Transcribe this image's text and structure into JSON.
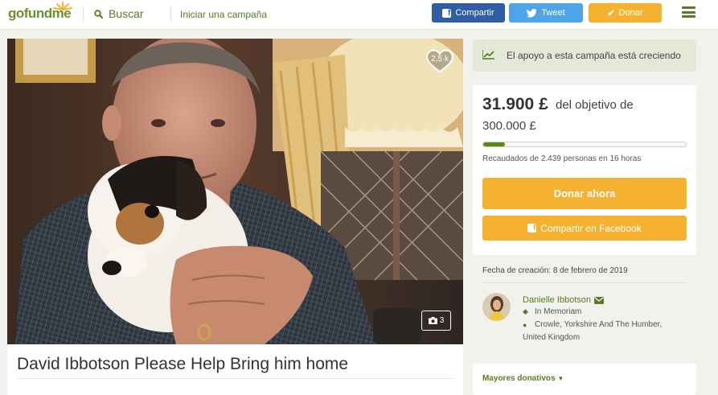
{
  "header": {
    "logo": "gofundme",
    "search_label": "Buscar",
    "start_campaign": "Iniciar una campaña",
    "share_label": "Compartir",
    "tweet_label": "Tweet",
    "donate_label": "Donar"
  },
  "photo": {
    "likes": "2,5 k",
    "photo_count": "3"
  },
  "campaign": {
    "title": "David Ibbotson Please Help Bring him home"
  },
  "sidebar": {
    "trend_banner": "El apoyo a esta campaña está creciendo",
    "raised": "31.900 £",
    "goal_prefix": "del objetivo de",
    "goal": "300.000 £",
    "progress_fraction": 0.106,
    "stats": "Recaudados de 2.439 personas en 16 horas",
    "donate_now": "Donar ahora",
    "share_facebook": "Compartir en Facebook",
    "created": "Fecha de creación: 8 de febrero de 2019",
    "organizer_name": "Danielle Ibbotson",
    "category": "In Memoriam",
    "location_line1": "Crowle, Yorkshire And The Humber,",
    "location_line2": "United Kingdom",
    "top_donations": "Mayores donativos"
  },
  "colors": {
    "brand_green": "#5a7a25",
    "accent_orange": "#f5b231",
    "facebook_blue": "#2f5ea4",
    "twitter_blue": "#4ea4e6"
  }
}
